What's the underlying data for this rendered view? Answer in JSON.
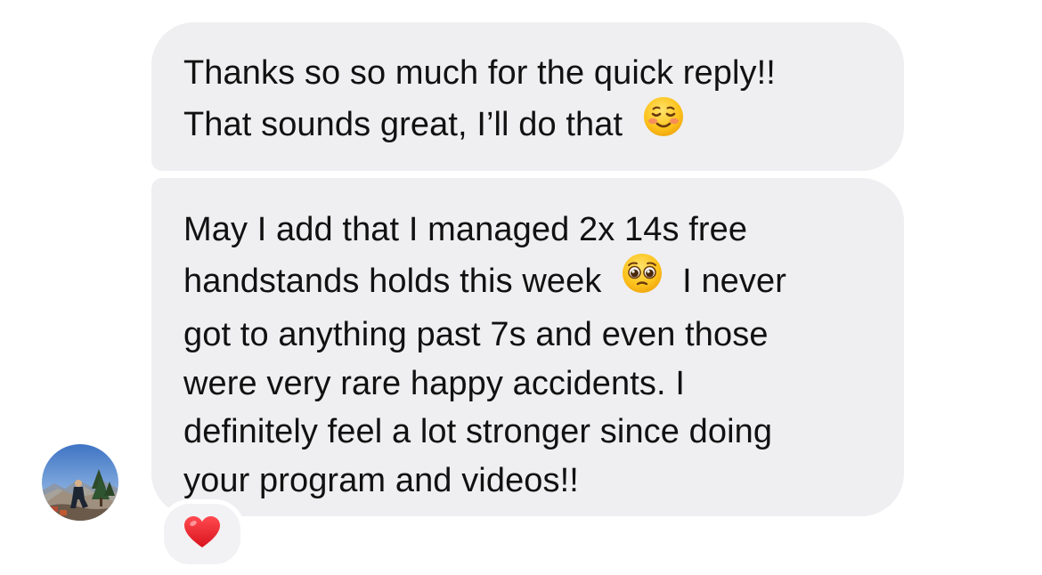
{
  "messages": [
    {
      "lines": [
        "Thanks so so much for the quick reply!!",
        "That sounds great, I’ll do that"
      ],
      "emoji": "smiling-face-emoji"
    },
    {
      "line1": "May I add that I managed 2x 14s free",
      "line2_before": "handstands holds this week",
      "line2_after": "I never",
      "line3": "got to anything past 7s and even those",
      "line4": "were very rare happy accidents. I",
      "line5": "definitely feel a lot stronger since doing",
      "line6": "your program and videos!!",
      "emoji": "pleading-face-emoji"
    }
  ],
  "reaction": {
    "emoji": "red-heart-emoji"
  },
  "colors": {
    "bubble_bg": "#efeff1",
    "text": "#111111",
    "heart": "#e8242d"
  }
}
